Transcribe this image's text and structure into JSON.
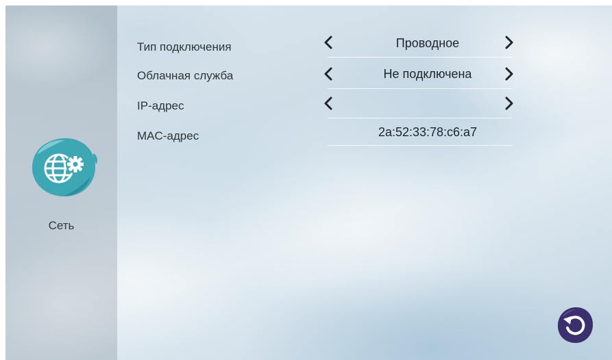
{
  "sidebar": {
    "items": [
      {
        "label": "Сеть",
        "icon": "globe-gear-icon"
      }
    ]
  },
  "settings": {
    "rows": [
      {
        "label": "Тип подключения",
        "value": "Проводное",
        "has_arrows": true
      },
      {
        "label": "Облачная служба",
        "value": "Не подключена",
        "has_arrows": true
      },
      {
        "label": "IP-адрес",
        "value": "",
        "has_arrows": true
      },
      {
        "label": "MAC-адрес",
        "value": "2a:52:33:78:c6:a7",
        "has_arrows": false
      }
    ]
  },
  "footer": {
    "back_icon": "back-arrow-icon"
  },
  "colors": {
    "icon_teal": "#3ea7b4",
    "back_button": "#3b2f6e",
    "text": "#2e3438"
  }
}
